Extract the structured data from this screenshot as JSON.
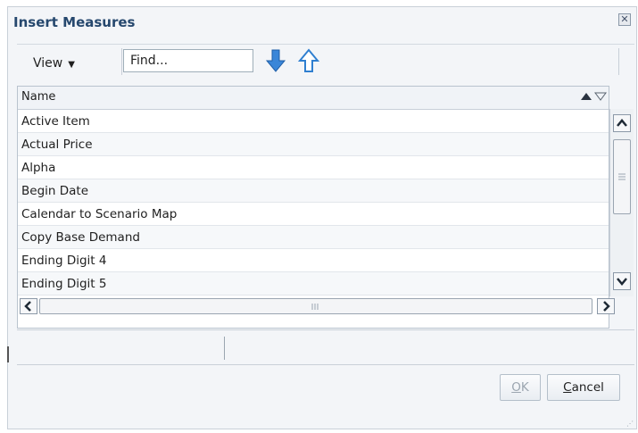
{
  "dialog": {
    "title": "Insert Measures",
    "close_icon": "close-icon"
  },
  "toolbar": {
    "view_label": "View",
    "find_placeholder": "Find...",
    "find_value": "",
    "down_arrow_icon": "arrow-down-icon",
    "up_arrow_icon": "arrow-up-icon"
  },
  "table": {
    "column_header": "Name",
    "sort_icons": [
      "sort-ascending-icon",
      "sort-descending-icon"
    ],
    "rows": [
      "Active Item",
      "Actual Price",
      "Alpha",
      "Begin Date",
      "Calendar to Scenario Map",
      "Copy Base Demand",
      "Ending Digit 4",
      "Ending Digit 5"
    ]
  },
  "buttons": {
    "ok_label_mn": "O",
    "ok_label_rest": "K",
    "cancel_label_mn": "C",
    "cancel_label_rest": "ancel"
  },
  "colors": {
    "title": "#26486e",
    "arrow": "#3a86d8",
    "border": "#c9d0d8"
  }
}
